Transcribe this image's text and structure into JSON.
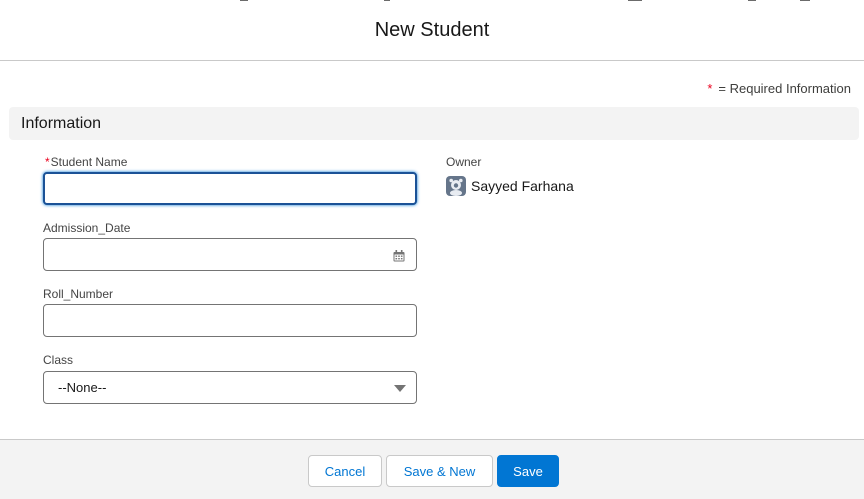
{
  "modal": {
    "title": "New Student"
  },
  "required_note": {
    "star": "*",
    "text": "= Required Information"
  },
  "section": {
    "title": "Information"
  },
  "fields": {
    "student_name": {
      "required_mark": "*",
      "label": "Student Name",
      "value": ""
    },
    "admission_date": {
      "label": "Admission_Date",
      "value": "",
      "icon": "calendar-icon"
    },
    "roll_number": {
      "label": "Roll_Number",
      "value": ""
    },
    "class": {
      "label": "Class",
      "selected": "--None--",
      "icon": "chevron-down-icon"
    }
  },
  "owner": {
    "label": "Owner",
    "name": "Sayyed Farhana",
    "icon": "user-avatar-icon"
  },
  "footer": {
    "cancel_label": "Cancel",
    "save_new_label": "Save & New",
    "save_label": "Save"
  },
  "colors": {
    "brand": "#0176d3",
    "focus_border": "#1b5297",
    "required": "#ea001e",
    "section_bg": "#f3f3f3"
  }
}
